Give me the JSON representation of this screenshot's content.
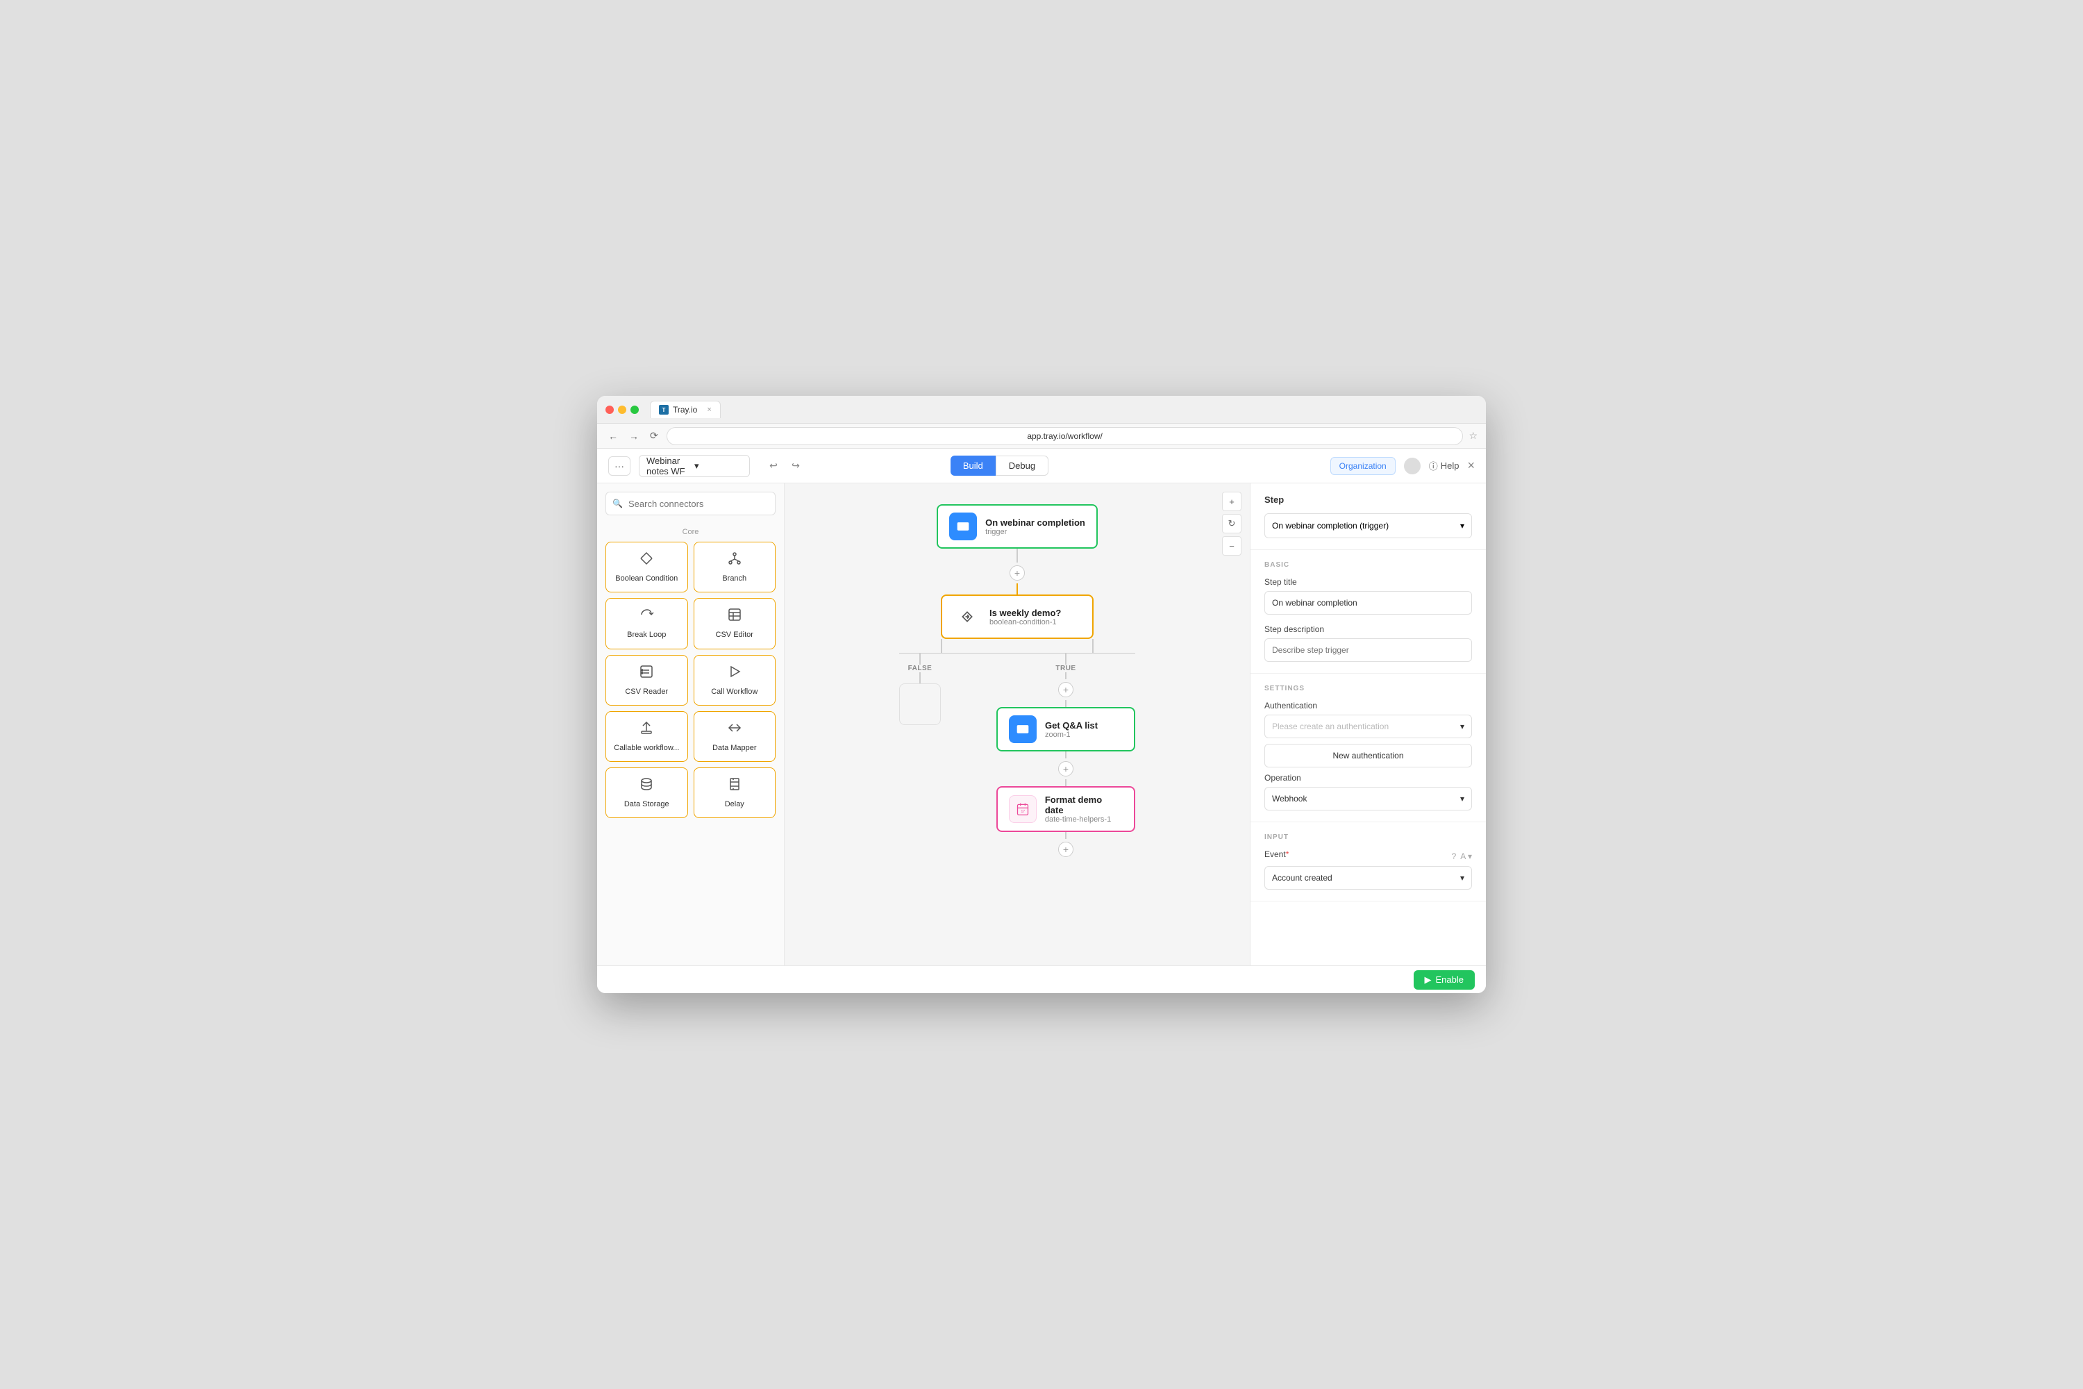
{
  "window": {
    "title": "Tray.io",
    "tab_close": "×",
    "url": "app.tray.io/workflow/"
  },
  "toolbar": {
    "menu_dots": "···",
    "workflow_name": "Webinar notes WF",
    "undo_icon": "↩",
    "redo_icon": "↪",
    "build_label": "Build",
    "debug_label": "Debug",
    "org_label": "Organization",
    "help_label": "Help",
    "close_icon": "×"
  },
  "sidebar": {
    "search_placeholder": "Search connectors",
    "section_label": "Core",
    "connectors": [
      {
        "id": "boolean-condition",
        "label": "Boolean Condition",
        "icon": "⊿"
      },
      {
        "id": "branch",
        "label": "Branch",
        "icon": "⑂"
      },
      {
        "id": "break-loop",
        "label": "Break Loop",
        "icon": "↺"
      },
      {
        "id": "csv-editor",
        "label": "CSV Editor",
        "icon": "▤"
      },
      {
        "id": "csv-reader",
        "label": "CSV Reader",
        "icon": "⊟"
      },
      {
        "id": "call-workflow",
        "label": "Call Workflow",
        "icon": "⚡"
      },
      {
        "id": "callable-workflow",
        "label": "Callable workflow...",
        "icon": "⬆"
      },
      {
        "id": "data-mapper",
        "label": "Data Mapper",
        "icon": "⇌"
      },
      {
        "id": "data-storage",
        "label": "Data Storage",
        "icon": "🗄"
      },
      {
        "id": "delay",
        "label": "Delay",
        "icon": "⏳"
      }
    ]
  },
  "canvas": {
    "zoom_in": "+",
    "zoom_out": "−",
    "refresh": "↻",
    "nodes": [
      {
        "id": "trigger",
        "title": "On webinar completion",
        "sub": "trigger",
        "type": "trigger"
      },
      {
        "id": "condition",
        "title": "Is weekly demo?",
        "sub": "boolean-condition-1",
        "type": "condition"
      },
      {
        "id": "get-qa",
        "title": "Get Q&A list",
        "sub": "zoom-1",
        "type": "zoom"
      },
      {
        "id": "format-date",
        "title": "Format demo date",
        "sub": "date-time-helpers-1",
        "type": "datetime"
      }
    ],
    "branch_false": "FALSE",
    "branch_true": "TRUE",
    "add_icon": "+"
  },
  "right_panel": {
    "step_title": "Step",
    "step_dropdown": "On webinar completion (trigger)",
    "basic_header": "BASIC",
    "step_title_label": "Step title",
    "step_title_value": "On webinar completion",
    "step_desc_label": "Step description",
    "step_desc_placeholder": "Describe step trigger",
    "settings_header": "SETTINGS",
    "auth_label": "Authentication",
    "auth_placeholder": "Please create an authentication",
    "new_auth_label": "New authentication",
    "operation_label": "Operation",
    "operation_value": "Webhook",
    "input_header": "INPUT",
    "event_label": "Event",
    "event_required": "*",
    "event_value": "Account created",
    "chevron_down": "▾",
    "help_icon": "?",
    "a_icon": "A"
  },
  "bottom_bar": {
    "enable_label": "Enable",
    "play_icon": "▶"
  }
}
